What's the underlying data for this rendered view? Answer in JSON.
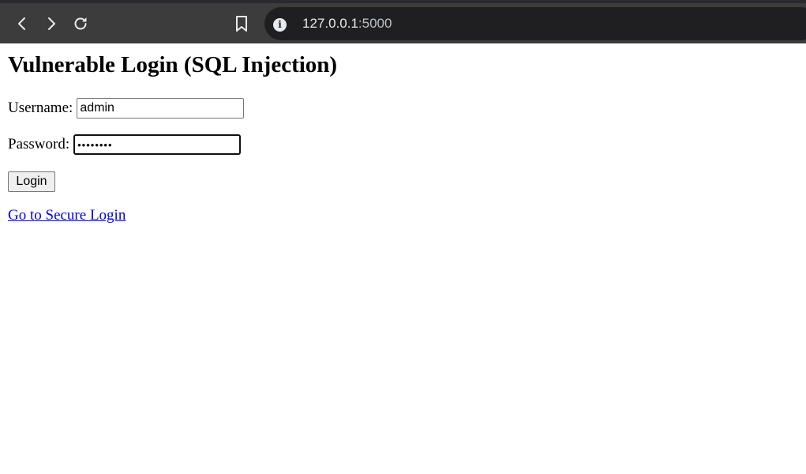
{
  "browser": {
    "url_host": "127.0.0.1",
    "url_port": ":5000",
    "icons": {
      "back": "chevron-left-icon",
      "forward": "chevron-right-icon",
      "reload": "reload-icon",
      "bookmark": "bookmark-icon",
      "site_info": "info-icon"
    },
    "colors": {
      "toolbar": "#3c3c3c",
      "omnibox": "#1f1f21",
      "url_text": "#e8eaed"
    }
  },
  "page": {
    "title": "Vulnerable Login (SQL Injection)",
    "username_label": "Username:",
    "username_value": "admin",
    "password_label": "Password:",
    "password_value": "••••••••",
    "login_label": "Login",
    "secure_link_text": "Go to Secure Login",
    "colors": {
      "link": "#0000ee"
    }
  }
}
